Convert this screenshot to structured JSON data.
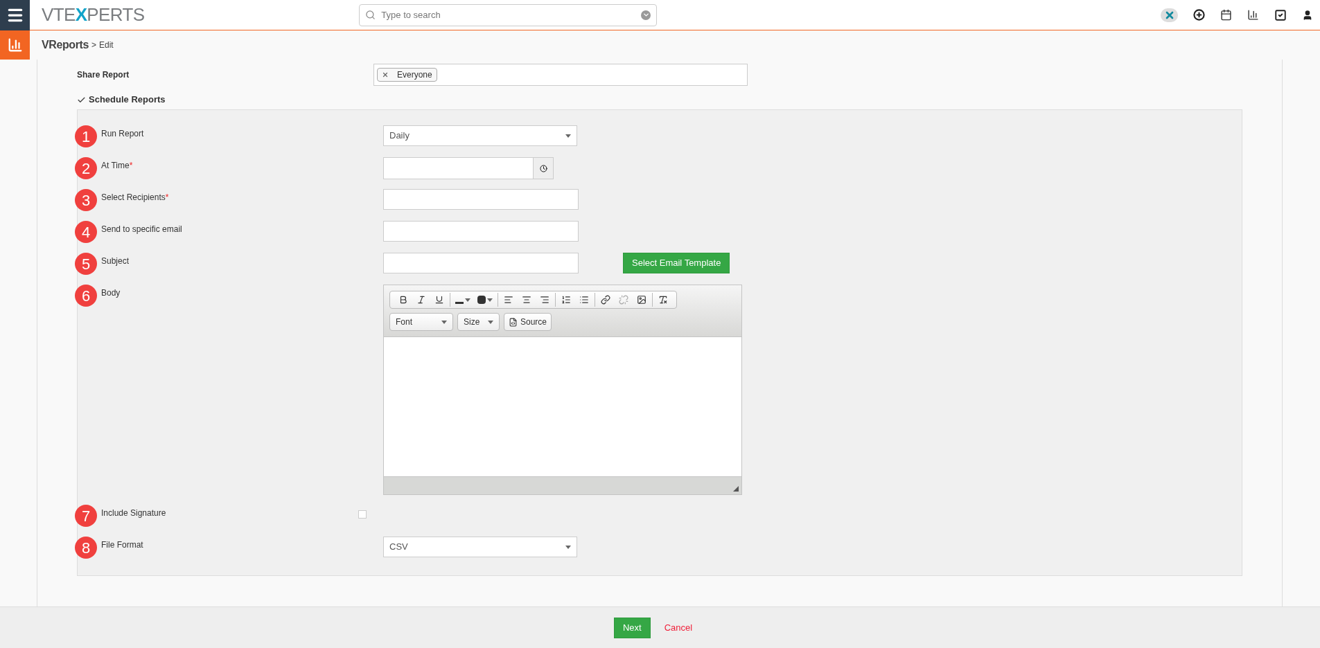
{
  "header": {
    "logo": "VTEXPERTS",
    "search": {
      "placeholder": "Type to search"
    }
  },
  "breadcrumb": {
    "module": "VReports",
    "separator": ">",
    "page": "Edit"
  },
  "share_report": {
    "label": "Share Report",
    "tags": [
      "Everyone"
    ]
  },
  "schedule": {
    "label": "Schedule Reports",
    "checked": true
  },
  "fields": [
    {
      "number": "1",
      "label": "Run Report",
      "kind": "select",
      "value": "Daily"
    },
    {
      "number": "2",
      "label": "At Time",
      "required_mark": "*",
      "kind": "time"
    },
    {
      "number": "3",
      "label": "Select Recipients",
      "required_mark": "*",
      "kind": "text"
    },
    {
      "number": "4",
      "label": "Send to specific email",
      "kind": "text"
    },
    {
      "number": "5",
      "label": "Subject",
      "kind": "text",
      "button": "Select Email Template"
    },
    {
      "number": "6",
      "label": "Body",
      "kind": "editor",
      "font": "Font",
      "size": "Size",
      "source": "Source"
    },
    {
      "number": "7",
      "label": "Include Signature",
      "kind": "checkbox",
      "checked": false
    },
    {
      "number": "8",
      "label": "File Format",
      "kind": "select",
      "value": "CSV"
    }
  ],
  "footer": {
    "primary": "Next",
    "cancel": "Cancel"
  }
}
